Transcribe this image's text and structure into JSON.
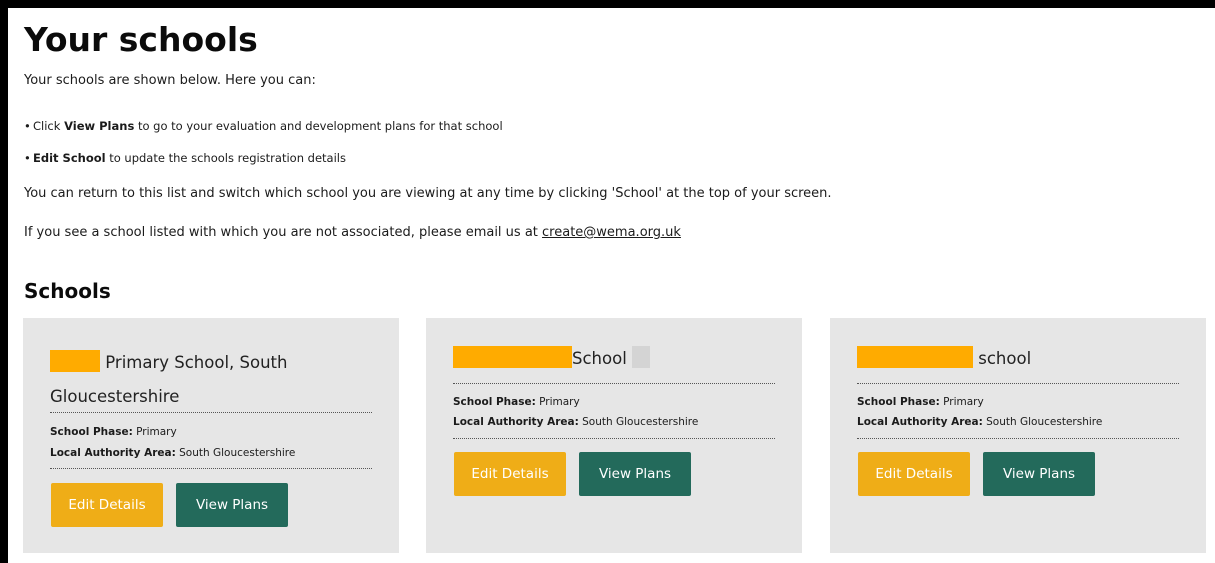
{
  "page": {
    "title": "Your schools",
    "intro": "Your schools are shown below. Here you can:",
    "bullets": [
      {
        "bold": "View Plans",
        "prefix": "Click ",
        "suffix": " to go to your evaluation and development plans for that school"
      },
      {
        "bold": "Edit School",
        "prefix": "",
        "suffix": " to update the schools registration details"
      }
    ],
    "para1": "You can return to this list and switch which school you are viewing at any time by clicking 'School' at the top of your screen.",
    "para2_prefix": "If you see a school listed with which you are not associated, please email us at ",
    "email": "create@wema.org.uk",
    "section_title": "Schools"
  },
  "labels": {
    "phase": "School Phase:",
    "la": "Local Authority Area:"
  },
  "schools": [
    {
      "name_suffix": "Primary School, South Gloucestershire",
      "phase": "Primary",
      "la": "South Gloucestershire",
      "edit_label": "Edit Details",
      "view_label": "View Plans"
    },
    {
      "name_suffix": "School",
      "phase": "Primary",
      "la": "South Gloucestershire",
      "edit_label": "Edit Details",
      "view_label": "View Plans"
    },
    {
      "name_suffix": "school",
      "phase": "Primary",
      "la": "South Gloucestershire",
      "edit_label": "Edit Details",
      "view_label": "View Plans"
    }
  ],
  "colors": {
    "edit_button": "#efad17",
    "view_button": "#236a5b",
    "card_bg": "#e6e6e6",
    "redaction": "#ffab00"
  }
}
